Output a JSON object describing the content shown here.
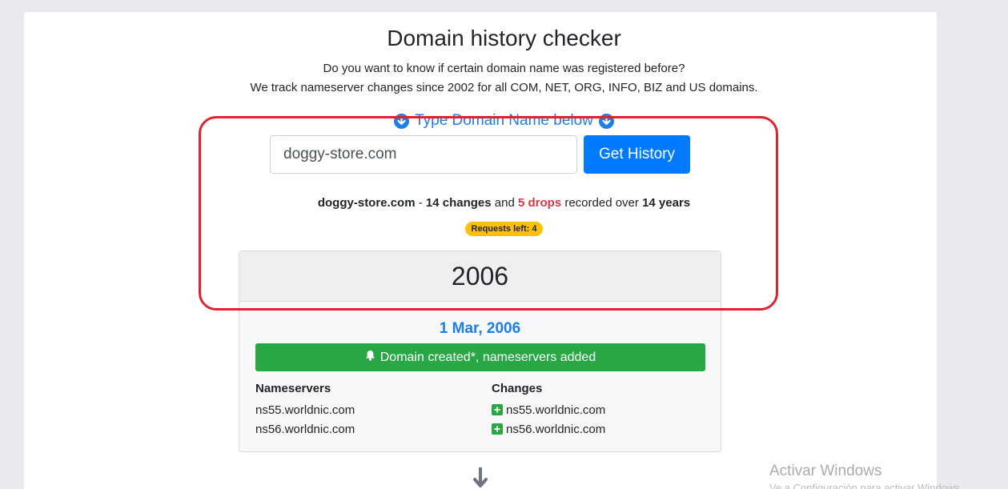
{
  "header": {
    "title": "Domain history checker",
    "subtitle_line1": "Do you want to know if certain domain name was registered before?",
    "subtitle_line2": "We track nameserver changes since 2002 for all COM, NET, ORG, INFO, BIZ and US domains."
  },
  "search": {
    "hint": "Type Domain Name below",
    "input_value": "doggy-store.com",
    "button_label": "Get History"
  },
  "summary": {
    "domain": "doggy-store.com",
    "sep": " - ",
    "changes": "14 changes",
    "and": " and ",
    "drops": "5 drops",
    "recorded_over": " recorded over ",
    "years": "14 years"
  },
  "badge": {
    "label": "Requests left: 4"
  },
  "timeline": {
    "year": "2006",
    "event": {
      "date": "1 Mar, 2006",
      "description": "Domain created*, nameservers added",
      "nameservers_header": "Nameservers",
      "nameservers": [
        "ns55.worldnic.com",
        "ns56.worldnic.com"
      ],
      "changes_header": "Changes",
      "changes": [
        "ns55.worldnic.com",
        "ns56.worldnic.com"
      ]
    }
  },
  "watermark": {
    "line1": "Activar Windows",
    "line2": "Ve a Configuración para activar Windows."
  },
  "colors": {
    "accent": "#007bff",
    "link_blue": "#1e7ee8",
    "success": "#28a745",
    "danger": "#dc3545",
    "warning": "#ffc107",
    "highlight": "#e0222f"
  },
  "icons": {
    "hint_left": "circle-arrow-down-icon",
    "hint_right": "circle-arrow-down-icon",
    "event": "bell-icon",
    "change_add": "plus-square-icon",
    "next": "arrow-down-icon"
  }
}
